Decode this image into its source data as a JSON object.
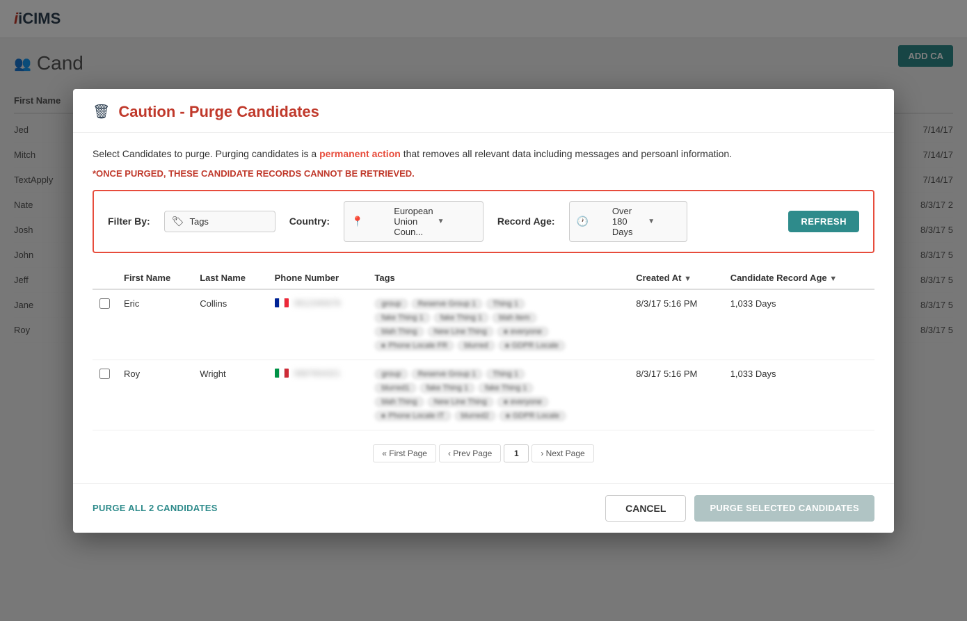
{
  "app": {
    "logo": "iCIMS",
    "page_title": "Cand",
    "add_button": "ADD CA"
  },
  "modal": {
    "title": "Caution - Purge Candidates",
    "warning_text_before": "Select Candidates to purge. Purging candidates is a",
    "warning_highlight": "permanent action",
    "warning_text_after": "that removes all relevant data including messages and persoanl information.",
    "warning_once": "*ONCE PURGED, THESE CANDIDATE RECORDS CANNOT BE RETRIEVED.",
    "filter": {
      "label": "Filter By:",
      "tags_placeholder": "Tags",
      "country_label": "Country:",
      "country_value": "European Union Coun...",
      "record_age_label": "Record Age:",
      "record_age_value": "Over 180 Days",
      "refresh_button": "REFRESH"
    },
    "table": {
      "columns": [
        "",
        "First Name",
        "Last Name",
        "Phone Number",
        "Tags",
        "Created At",
        "Candidate Record Age"
      ],
      "rows": [
        {
          "id": 1,
          "first_name": "Eric",
          "last_name": "Collins",
          "flag": "fr",
          "phone": "██████████",
          "tags": [
            "group",
            "Reserve Group 1",
            "Thing 1",
            "fake Thing 1",
            "fake Thing 1",
            "blurred",
            "blah Thing",
            "New Line Thing",
            "everyone",
            "Phone Locale FR",
            "blurred2",
            "GDPR Locale"
          ],
          "created_at": "8/3/17 5:16 PM",
          "record_age": "1,033 Days"
        },
        {
          "id": 2,
          "first_name": "Roy",
          "last_name": "Wright",
          "flag": "it",
          "phone": "██████████",
          "tags": [
            "group",
            "Reserve Group 1",
            "Thing 1",
            "blurred1",
            "fake Thing 1",
            "fake Thing 1",
            "blah Thing",
            "New Line Thing",
            "everyone",
            "Phone Locale IT",
            "blurred2",
            "GDPR Locale"
          ],
          "created_at": "8/3/17 5:16 PM",
          "record_age": "1,033 Days"
        }
      ]
    },
    "pagination": {
      "first_page": "« First Page",
      "prev_page": "‹ Prev Page",
      "current_page": "1",
      "next_page": "› Next Page"
    },
    "footer": {
      "purge_all": "PURGE ALL 2 CANDIDATES",
      "cancel": "CANCEL",
      "purge_selected": "PURGE SELECTED CANDIDATES"
    }
  },
  "bg_rows": [
    {
      "first": "Jed",
      "created": "7/14/17"
    },
    {
      "first": "Mitch",
      "created": "7/14/17"
    },
    {
      "first": "TextApply",
      "created": "7/14/17"
    },
    {
      "first": "Nate",
      "created": "8/3/17 2"
    },
    {
      "first": "Josh",
      "created": "8/3/17 5"
    },
    {
      "first": "John",
      "created": "8/3/17 5"
    },
    {
      "first": "Jeff",
      "created": "8/3/17 5"
    },
    {
      "first": "Jane",
      "created": "8/3/17 5"
    },
    {
      "first": "Roy",
      "created": "8/3/17 5"
    }
  ]
}
